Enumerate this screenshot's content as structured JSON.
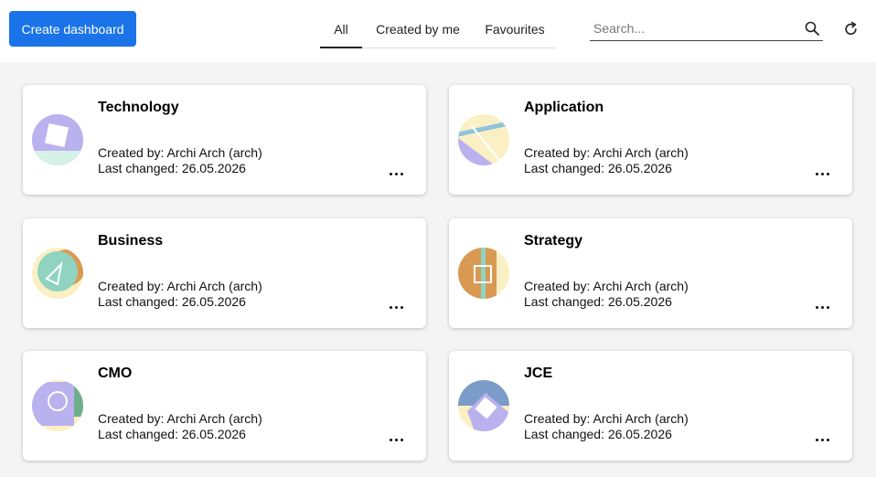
{
  "toolbar": {
    "create_label": "Create dashboard",
    "tabs": [
      "All",
      "Created by me",
      "Favourites"
    ],
    "active_tab": "All",
    "search_placeholder": "Search...",
    "search_value": ""
  },
  "colors": {
    "primary": "#1a73e8",
    "lavender": "#b9b2ee",
    "mint": "#8fd3c0",
    "cream": "#fbefc4",
    "orange": "#d89a53",
    "sky": "#8ec4dc",
    "green": "#6fae8a",
    "steel": "#7b9cc8"
  },
  "dashboards": [
    {
      "name": "Technology",
      "created_by": "Created by: Archi Arch (arch)",
      "last_changed": "Last changed: 26.05.2026"
    },
    {
      "name": "Application",
      "created_by": "Created by: Archi Arch (arch)",
      "last_changed": "Last changed: 26.05.2026"
    },
    {
      "name": "Business",
      "created_by": "Created by: Archi Arch (arch)",
      "last_changed": "Last changed: 26.05.2026"
    },
    {
      "name": "Strategy",
      "created_by": "Created by: Archi Arch (arch)",
      "last_changed": "Last changed: 26.05.2026"
    },
    {
      "name": "CMO",
      "created_by": "Created by: Archi Arch (arch)",
      "last_changed": "Last changed: 26.05.2026"
    },
    {
      "name": "JCE",
      "created_by": "Created by: Archi Arch (arch)",
      "last_changed": "Last changed: 26.05.2026"
    }
  ]
}
